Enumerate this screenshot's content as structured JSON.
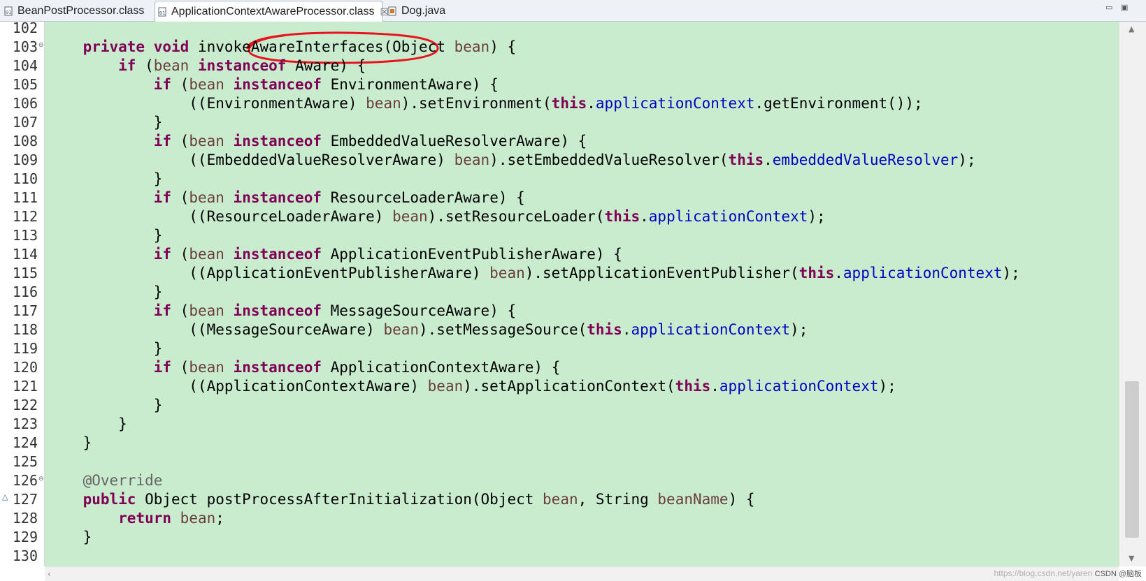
{
  "tabs": [
    {
      "label": "BeanPostProcessor.class",
      "icon": "class-file-icon",
      "active": false
    },
    {
      "label": "ApplicationContextAwareProcessor.class",
      "icon": "class-file-icon",
      "active": true,
      "close": "☒"
    },
    {
      "label": "Dog.java",
      "icon": "java-file-icon",
      "active": false
    }
  ],
  "window_controls": {
    "minimize": "▭",
    "maximize": "▣"
  },
  "colors": {
    "editor_bg": "#c9ecce",
    "keyword": "#7f0055",
    "variable": "#6a3e3e",
    "field": "#0000c0",
    "annotation": "#646464",
    "marker": "#e8141d"
  },
  "editor": {
    "lines": [
      {
        "num": "102",
        "tokens": []
      },
      {
        "num": "103",
        "fold": "⊖",
        "tokens": [
          {
            "t": "    ",
            "c": "plain"
          },
          {
            "t": "private",
            "c": "kw"
          },
          {
            "t": " ",
            "c": "plain"
          },
          {
            "t": "void",
            "c": "kw"
          },
          {
            "t": " invokeAwareInterfaces(Object ",
            "c": "plain"
          },
          {
            "t": "bean",
            "c": "var"
          },
          {
            "t": ") {",
            "c": "plain"
          }
        ]
      },
      {
        "num": "104",
        "tokens": [
          {
            "t": "        ",
            "c": "plain"
          },
          {
            "t": "if",
            "c": "kw"
          },
          {
            "t": " (",
            "c": "plain"
          },
          {
            "t": "bean",
            "c": "var"
          },
          {
            "t": " ",
            "c": "plain"
          },
          {
            "t": "instanceof",
            "c": "kw"
          },
          {
            "t": " Aware) {",
            "c": "plain"
          }
        ]
      },
      {
        "num": "105",
        "tokens": [
          {
            "t": "            ",
            "c": "plain"
          },
          {
            "t": "if",
            "c": "kw"
          },
          {
            "t": " (",
            "c": "plain"
          },
          {
            "t": "bean",
            "c": "var"
          },
          {
            "t": " ",
            "c": "plain"
          },
          {
            "t": "instanceof",
            "c": "kw"
          },
          {
            "t": " EnvironmentAware) {",
            "c": "plain"
          }
        ]
      },
      {
        "num": "106",
        "tokens": [
          {
            "t": "                ((EnvironmentAware) ",
            "c": "plain"
          },
          {
            "t": "bean",
            "c": "var"
          },
          {
            "t": ").setEnvironment(",
            "c": "plain"
          },
          {
            "t": "this",
            "c": "kw"
          },
          {
            "t": ".",
            "c": "plain"
          },
          {
            "t": "applicationContext",
            "c": "fld"
          },
          {
            "t": ".getEnvironment());",
            "c": "plain"
          }
        ]
      },
      {
        "num": "107",
        "tokens": [
          {
            "t": "            }",
            "c": "plain"
          }
        ]
      },
      {
        "num": "108",
        "tokens": [
          {
            "t": "            ",
            "c": "plain"
          },
          {
            "t": "if",
            "c": "kw"
          },
          {
            "t": " (",
            "c": "plain"
          },
          {
            "t": "bean",
            "c": "var"
          },
          {
            "t": " ",
            "c": "plain"
          },
          {
            "t": "instanceof",
            "c": "kw"
          },
          {
            "t": " EmbeddedValueResolverAware) {",
            "c": "plain"
          }
        ]
      },
      {
        "num": "109",
        "tokens": [
          {
            "t": "                ((EmbeddedValueResolverAware) ",
            "c": "plain"
          },
          {
            "t": "bean",
            "c": "var"
          },
          {
            "t": ").setEmbeddedValueResolver(",
            "c": "plain"
          },
          {
            "t": "this",
            "c": "kw"
          },
          {
            "t": ".",
            "c": "plain"
          },
          {
            "t": "embeddedValueResolver",
            "c": "fld"
          },
          {
            "t": ");",
            "c": "plain"
          }
        ]
      },
      {
        "num": "110",
        "tokens": [
          {
            "t": "            }",
            "c": "plain"
          }
        ]
      },
      {
        "num": "111",
        "tokens": [
          {
            "t": "            ",
            "c": "plain"
          },
          {
            "t": "if",
            "c": "kw"
          },
          {
            "t": " (",
            "c": "plain"
          },
          {
            "t": "bean",
            "c": "var"
          },
          {
            "t": " ",
            "c": "plain"
          },
          {
            "t": "instanceof",
            "c": "kw"
          },
          {
            "t": " ResourceLoaderAware) {",
            "c": "plain"
          }
        ]
      },
      {
        "num": "112",
        "tokens": [
          {
            "t": "                ((ResourceLoaderAware) ",
            "c": "plain"
          },
          {
            "t": "bean",
            "c": "var"
          },
          {
            "t": ").setResourceLoader(",
            "c": "plain"
          },
          {
            "t": "this",
            "c": "kw"
          },
          {
            "t": ".",
            "c": "plain"
          },
          {
            "t": "applicationContext",
            "c": "fld"
          },
          {
            "t": ");",
            "c": "plain"
          }
        ]
      },
      {
        "num": "113",
        "tokens": [
          {
            "t": "            }",
            "c": "plain"
          }
        ]
      },
      {
        "num": "114",
        "tokens": [
          {
            "t": "            ",
            "c": "plain"
          },
          {
            "t": "if",
            "c": "kw"
          },
          {
            "t": " (",
            "c": "plain"
          },
          {
            "t": "bean",
            "c": "var"
          },
          {
            "t": " ",
            "c": "plain"
          },
          {
            "t": "instanceof",
            "c": "kw"
          },
          {
            "t": " ApplicationEventPublisherAware) {",
            "c": "plain"
          }
        ]
      },
      {
        "num": "115",
        "tokens": [
          {
            "t": "                ((ApplicationEventPublisherAware) ",
            "c": "plain"
          },
          {
            "t": "bean",
            "c": "var"
          },
          {
            "t": ").setApplicationEventPublisher(",
            "c": "plain"
          },
          {
            "t": "this",
            "c": "kw"
          },
          {
            "t": ".",
            "c": "plain"
          },
          {
            "t": "applicationContext",
            "c": "fld"
          },
          {
            "t": ");",
            "c": "plain"
          }
        ]
      },
      {
        "num": "116",
        "tokens": [
          {
            "t": "            }",
            "c": "plain"
          }
        ]
      },
      {
        "num": "117",
        "tokens": [
          {
            "t": "            ",
            "c": "plain"
          },
          {
            "t": "if",
            "c": "kw"
          },
          {
            "t": " (",
            "c": "plain"
          },
          {
            "t": "bean",
            "c": "var"
          },
          {
            "t": " ",
            "c": "plain"
          },
          {
            "t": "instanceof",
            "c": "kw"
          },
          {
            "t": " MessageSourceAware) {",
            "c": "plain"
          }
        ]
      },
      {
        "num": "118",
        "tokens": [
          {
            "t": "                ((MessageSourceAware) ",
            "c": "plain"
          },
          {
            "t": "bean",
            "c": "var"
          },
          {
            "t": ").setMessageSource(",
            "c": "plain"
          },
          {
            "t": "this",
            "c": "kw"
          },
          {
            "t": ".",
            "c": "plain"
          },
          {
            "t": "applicationContext",
            "c": "fld"
          },
          {
            "t": ");",
            "c": "plain"
          }
        ]
      },
      {
        "num": "119",
        "tokens": [
          {
            "t": "            }",
            "c": "plain"
          }
        ]
      },
      {
        "num": "120",
        "tokens": [
          {
            "t": "            ",
            "c": "plain"
          },
          {
            "t": "if",
            "c": "kw"
          },
          {
            "t": " (",
            "c": "plain"
          },
          {
            "t": "bean",
            "c": "var"
          },
          {
            "t": " ",
            "c": "plain"
          },
          {
            "t": "instanceof",
            "c": "kw"
          },
          {
            "t": " ApplicationContextAware) {",
            "c": "plain"
          }
        ]
      },
      {
        "num": "121",
        "tokens": [
          {
            "t": "                ((ApplicationContextAware) ",
            "c": "plain"
          },
          {
            "t": "bean",
            "c": "var"
          },
          {
            "t": ").setApplicationContext(",
            "c": "plain"
          },
          {
            "t": "this",
            "c": "kw"
          },
          {
            "t": ".",
            "c": "plain"
          },
          {
            "t": "applicationContext",
            "c": "fld"
          },
          {
            "t": ");",
            "c": "plain"
          }
        ]
      },
      {
        "num": "122",
        "tokens": [
          {
            "t": "            }",
            "c": "plain"
          }
        ]
      },
      {
        "num": "123",
        "tokens": [
          {
            "t": "        }",
            "c": "plain"
          }
        ]
      },
      {
        "num": "124",
        "tokens": [
          {
            "t": "    }",
            "c": "plain"
          }
        ]
      },
      {
        "num": "125",
        "tokens": []
      },
      {
        "num": "126",
        "fold": "⊖",
        "tokens": [
          {
            "t": "    ",
            "c": "plain"
          },
          {
            "t": "@Override",
            "c": "ann"
          }
        ]
      },
      {
        "num": "127",
        "override_marker": "△",
        "tokens": [
          {
            "t": "    ",
            "c": "plain"
          },
          {
            "t": "public",
            "c": "kw"
          },
          {
            "t": " Object postProcessAfterInitialization(Object ",
            "c": "plain"
          },
          {
            "t": "bean",
            "c": "var"
          },
          {
            "t": ", String ",
            "c": "plain"
          },
          {
            "t": "beanName",
            "c": "var"
          },
          {
            "t": ") {",
            "c": "plain"
          }
        ]
      },
      {
        "num": "128",
        "tokens": [
          {
            "t": "        ",
            "c": "plain"
          },
          {
            "t": "return",
            "c": "kw"
          },
          {
            "t": " ",
            "c": "plain"
          },
          {
            "t": "bean",
            "c": "var"
          },
          {
            "t": ";",
            "c": "plain"
          }
        ]
      },
      {
        "num": "129",
        "tokens": [
          {
            "t": "    }",
            "c": "plain"
          }
        ]
      },
      {
        "num": "130",
        "tokens": []
      }
    ]
  },
  "scroll": {
    "up": "▲",
    "down": "▼",
    "left": "‹"
  },
  "watermark": {
    "url": "https://blog.csdn.net/yaren",
    "label": "CSDN @脑板"
  }
}
